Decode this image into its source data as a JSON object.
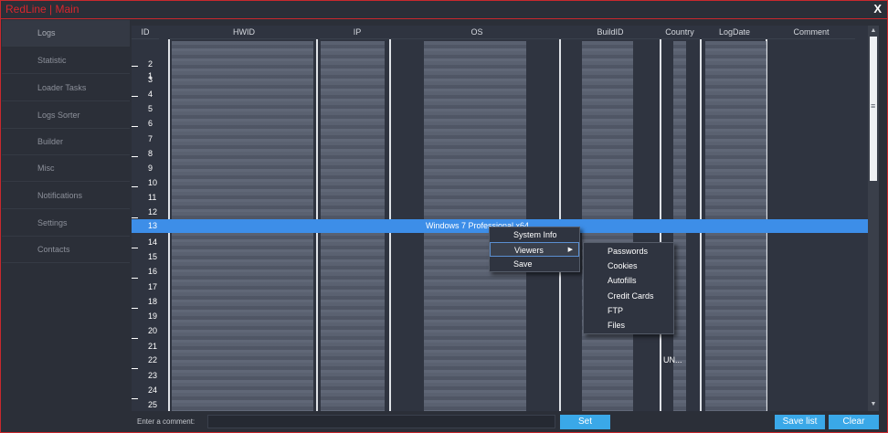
{
  "window": {
    "title": "RedLine | Main",
    "close_label": "X"
  },
  "sidebar": {
    "items": [
      {
        "label": "Logs",
        "active": true
      },
      {
        "label": "Statistic"
      },
      {
        "label": "Loader Tasks"
      },
      {
        "label": "Logs Sorter"
      },
      {
        "label": "Builder"
      },
      {
        "label": "Misc"
      },
      {
        "label": "Notifications"
      },
      {
        "label": "Settings"
      },
      {
        "label": "Contacts"
      }
    ]
  },
  "table": {
    "columns": [
      "ID",
      "HWID",
      "IP",
      "OS",
      "BuildID",
      "Country",
      "LogDate",
      "Comment"
    ],
    "row_ids": [
      "1",
      "2",
      "3",
      "4",
      "5",
      "6",
      "7",
      "8",
      "9",
      "10",
      "11",
      "12",
      "13",
      "14",
      "15",
      "16",
      "17",
      "18",
      "19",
      "20",
      "21",
      "22",
      "23",
      "24",
      "25"
    ],
    "selected_id": "13",
    "selected_os": "Windows 7 Professional x64",
    "visible_country_fragment": "UN..."
  },
  "context_menu": {
    "items": [
      {
        "label": "System Info"
      },
      {
        "label": "Viewers",
        "has_submenu": true,
        "highlighted": true
      },
      {
        "label": "Save"
      }
    ]
  },
  "submenu": {
    "items": [
      {
        "label": "Passwords"
      },
      {
        "label": "Cookies"
      },
      {
        "label": "Autofills"
      },
      {
        "label": "Credit Cards"
      },
      {
        "label": "FTP"
      },
      {
        "label": "Files"
      }
    ]
  },
  "bottom": {
    "comment_label": "Enter a comment:",
    "comment_value": "",
    "set_label": "Set",
    "save_list_label": "Save list",
    "clear_label": "Clear"
  },
  "colors": {
    "accent_red": "#d8262d",
    "selection_blue": "#3d8ee8",
    "button_blue": "#3aa8e8"
  },
  "icons": {
    "submenu_arrow": "caret-right-icon",
    "scroll_up": "chevron-up-icon",
    "scroll_down": "chevron-down-icon"
  }
}
